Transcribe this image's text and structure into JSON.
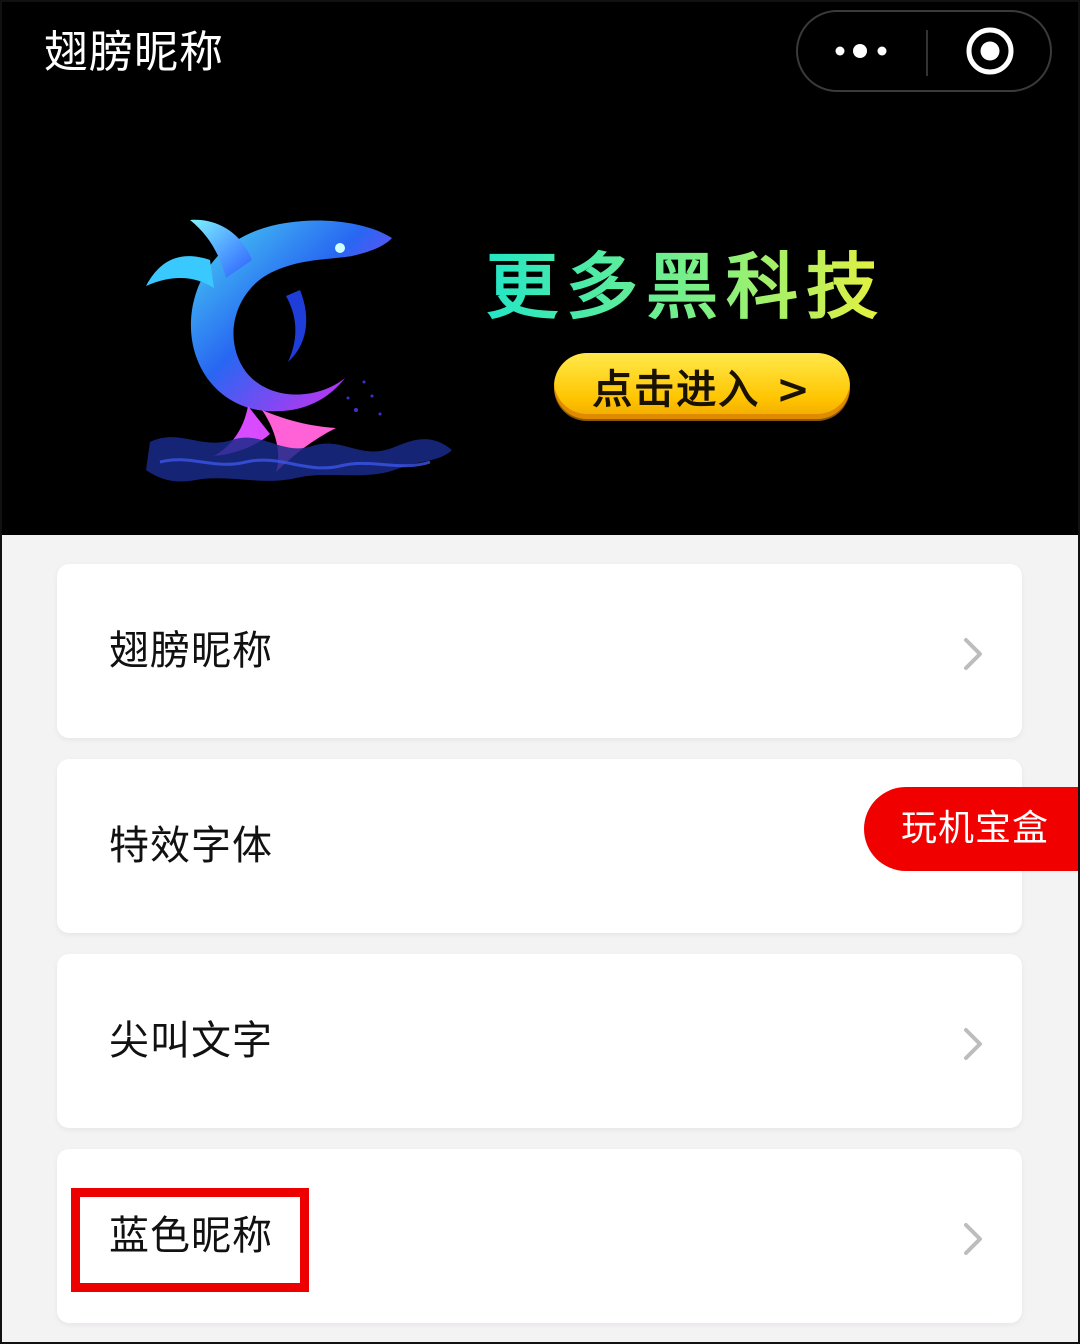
{
  "header": {
    "title": "翅膀昵称",
    "more_icon": "more-dots-icon",
    "close_icon": "miniprogram-close-icon"
  },
  "banner": {
    "headline": "更多黑科技",
    "cta_label": "点击进入 >",
    "image": "neon-dolphin-illustration"
  },
  "menu": {
    "items": [
      {
        "label": "翅膀昵称"
      },
      {
        "label": "特效字体"
      },
      {
        "label": "尖叫文字"
      },
      {
        "label": "蓝色昵称"
      }
    ]
  },
  "float_button": {
    "label": "玩机宝盒"
  },
  "colors": {
    "header_bg": "#000000",
    "page_bg": "#f4f3f4",
    "accent_red": "#f10000",
    "cta_yellow": "#ffd21a",
    "headline_gradient": [
      "#23e6c6",
      "#e9f03d"
    ]
  }
}
